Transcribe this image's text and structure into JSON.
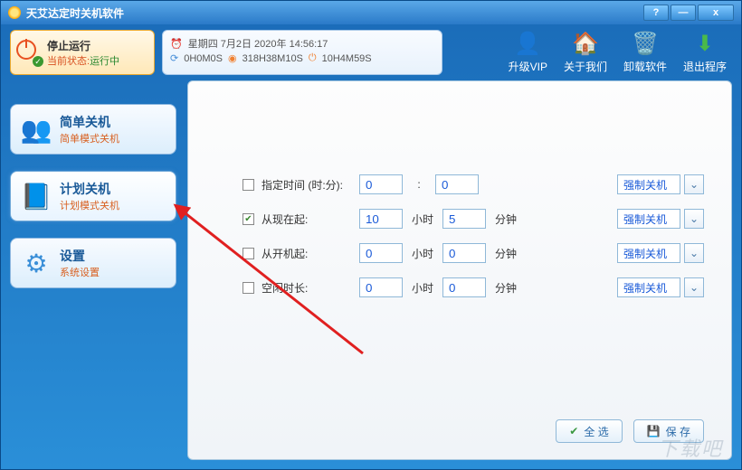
{
  "title": "天艾达定时关机软件",
  "win": {
    "help": "?",
    "min": "—",
    "close": "x"
  },
  "stop": {
    "title": "停止运行",
    "status_label": "当前状态:",
    "status_value": "运行中"
  },
  "info": {
    "date": "星期四 7月2日 2020年 14:56:17",
    "t1": "0H0M0S",
    "t2": "318H38M10S",
    "t3": "10H4M59S"
  },
  "toolbar": {
    "vip": "升级VIP",
    "about": "关于我们",
    "uninstall": "卸载软件",
    "exit": "退出程序"
  },
  "sidebar": {
    "simple": {
      "title": "简单关机",
      "sub": "简单模式关机"
    },
    "plan": {
      "title": "计划关机",
      "sub": "计划模式关机"
    },
    "settings": {
      "title": "设置",
      "sub": "系统设置"
    }
  },
  "form": {
    "row1": {
      "label": "指定时间 (时:分):",
      "v1": "0",
      "v2": "0",
      "action": "强制关机",
      "checked": false
    },
    "row2": {
      "label": "从现在起:",
      "v1": "10",
      "u1": "小时",
      "v2": "5",
      "u2": "分钟",
      "action": "强制关机",
      "checked": true
    },
    "row3": {
      "label": "从开机起:",
      "v1": "0",
      "u1": "小时",
      "v2": "0",
      "u2": "分钟",
      "action": "强制关机",
      "checked": false
    },
    "row4": {
      "label": "空闲时长:",
      "v1": "0",
      "u1": "小时",
      "v2": "0",
      "u2": "分钟",
      "action": "强制关机",
      "checked": false
    }
  },
  "buttons": {
    "select_all": "全 选",
    "save": "保 存"
  },
  "watermark": "下载吧"
}
